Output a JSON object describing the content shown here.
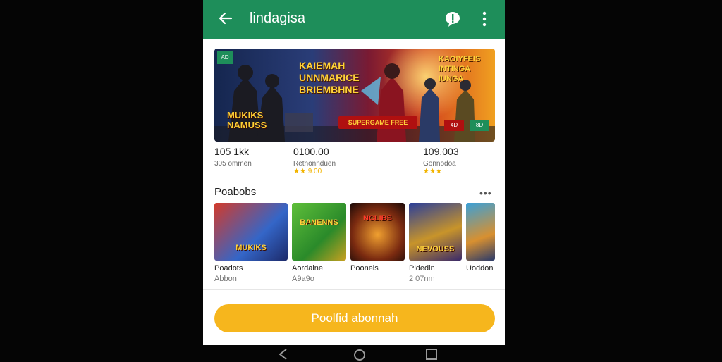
{
  "app_bar": {
    "title": "lindagisa",
    "back_icon": "arrow-left-icon",
    "chat_icon": "chat-bubble-alert-icon",
    "menu_icon": "more-vertical-icon",
    "color": "#1e8e5a"
  },
  "hero": {
    "title_left": "MUKIKS NAMUSS",
    "title_center": "KAIEMAH UNNMARICE BRIEMBHNE",
    "title_right": "KAOIYFEIS INTINGA IUNGA",
    "cta": "SUPERGAME FREE",
    "badge": "AD",
    "chip_red": "4D",
    "chip_green": "8D"
  },
  "stats": [
    {
      "value": "105 1kk",
      "sub": "305 ommen",
      "stars": ""
    },
    {
      "value": "0100.00",
      "sub": "Retnonnduen",
      "rating": "★★ 9.00"
    },
    {
      "value": "109.003",
      "sub": "Gonnodoa",
      "rating": "★★★"
    }
  ],
  "section": {
    "title": "Poabobs",
    "more_icon": "more-horizontal-icon"
  },
  "games": [
    {
      "name": "Poadots",
      "sub": "Abbon",
      "art_label": "MUKIKS"
    },
    {
      "name": "Aordaine",
      "sub": "A9a9o",
      "art_label": "BANENNS"
    },
    {
      "name": "Poonels",
      "sub": "",
      "art_label": "NCLIBS"
    },
    {
      "name": "Pidedin",
      "sub": "2 07nm",
      "art_label": "NEVOUSS"
    },
    {
      "name": "Uoddon",
      "sub": "",
      "art_label": ""
    }
  ],
  "primary_button": {
    "label": "Poolfid abonnah",
    "color": "#f6b61d"
  },
  "system_nav": {
    "back_icon": "nav-back-icon",
    "home_icon": "nav-home-icon",
    "recents_icon": "nav-recents-icon"
  }
}
